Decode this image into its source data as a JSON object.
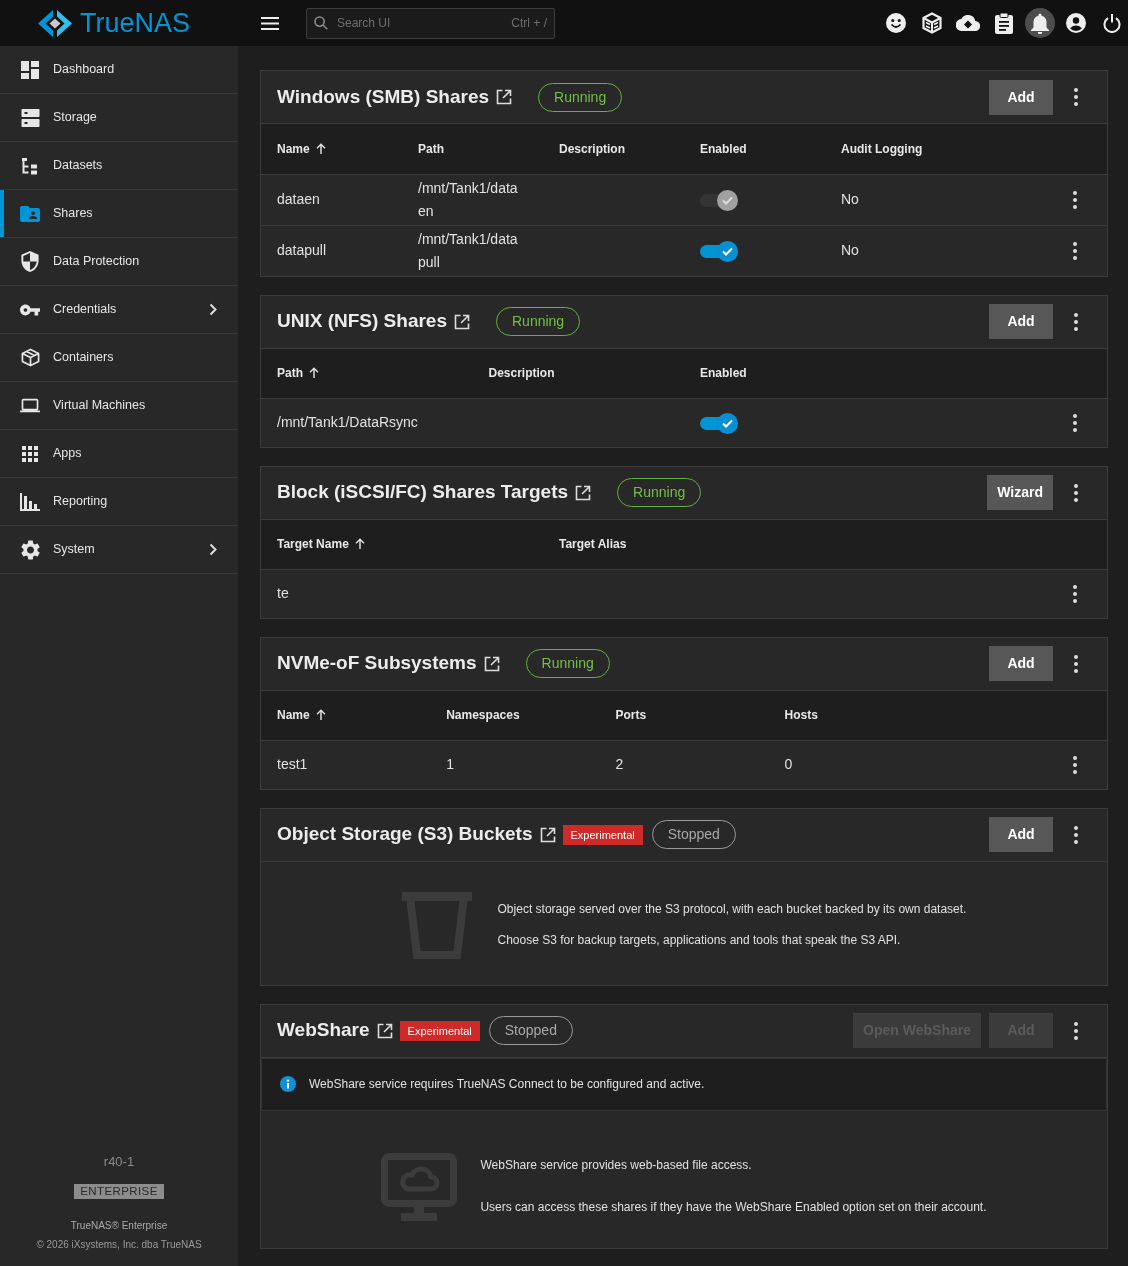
{
  "topbar": {
    "logo_text": "TrueNAS",
    "search": {
      "placeholder": "Search UI",
      "shortcut": "Ctrl + /"
    },
    "actions": [
      {
        "kind": "feedback",
        "highlighted": false
      },
      {
        "kind": "truecommand",
        "highlighted": false
      },
      {
        "kind": "connect",
        "highlighted": false
      },
      {
        "kind": "jobs",
        "highlighted": false
      },
      {
        "kind": "alerts",
        "highlighted": true
      },
      {
        "kind": "account",
        "highlighted": false
      },
      {
        "kind": "power",
        "highlighted": false
      }
    ]
  },
  "sidebar": {
    "items": [
      {
        "label": "Dashboard",
        "selected": false,
        "expandable": false
      },
      {
        "label": "Storage",
        "selected": false,
        "expandable": false
      },
      {
        "label": "Datasets",
        "selected": false,
        "expandable": false
      },
      {
        "label": "Shares",
        "selected": true,
        "expandable": false
      },
      {
        "label": "Data Protection",
        "selected": false,
        "expandable": false
      },
      {
        "label": "Credentials",
        "selected": false,
        "expandable": true
      },
      {
        "label": "Containers",
        "selected": false,
        "expandable": false
      },
      {
        "label": "Virtual Machines",
        "selected": false,
        "expandable": false
      },
      {
        "label": "Apps",
        "selected": false,
        "expandable": false
      },
      {
        "label": "Reporting",
        "selected": false,
        "expandable": false
      },
      {
        "label": "System",
        "selected": false,
        "expandable": true
      }
    ],
    "footer": {
      "hostname": "r40-1",
      "edition": "ENTERPRISE",
      "product": "TrueNAS® Enterprise",
      "copyright": "© 2026 iXsystems, Inc. dba",
      "copyright_link": "TrueNAS"
    }
  },
  "cards": [
    {
      "kind": "table",
      "title": "Windows (SMB) Shares",
      "status": {
        "kind": "running",
        "label": "Running"
      },
      "buttons": [
        {
          "label": "Add",
          "disabled": false
        }
      ],
      "columns": [
        {
          "label": "Name",
          "kind": "text",
          "sorted": true
        },
        {
          "label": "Path",
          "kind": "text",
          "sorted": false
        },
        {
          "label": "Description",
          "kind": "text",
          "sorted": false
        },
        {
          "label": "Enabled",
          "kind": "toggle",
          "sorted": false
        },
        {
          "label": "Audit Logging",
          "kind": "text",
          "sorted": false
        }
      ],
      "rows": [
        {
          "cells": [
            "dataen",
            "/mnt/Tank1/dataen",
            null,
            false,
            "No"
          ]
        },
        {
          "cells": [
            "datapull",
            "/mnt/Tank1/datapull",
            null,
            true,
            "No"
          ]
        }
      ]
    },
    {
      "kind": "table",
      "title": "UNIX (NFS) Shares",
      "status": {
        "kind": "running",
        "label": "Running"
      },
      "buttons": [
        {
          "label": "Add",
          "disabled": false
        }
      ],
      "columns": [
        {
          "label": "Path",
          "kind": "text",
          "sorted": true
        },
        {
          "label": "Description",
          "kind": "text",
          "sorted": false
        },
        {
          "label": "Enabled",
          "kind": "toggle",
          "sorted": false
        }
      ],
      "rows": [
        {
          "cells": [
            "/mnt/Tank1/DataRsync",
            null,
            true
          ]
        }
      ]
    },
    {
      "kind": "table",
      "title": "Block (iSCSI/FC) Shares Targets",
      "status": {
        "kind": "running",
        "label": "Running"
      },
      "buttons": [
        {
          "label": "Wizard",
          "disabled": false
        }
      ],
      "columns": [
        {
          "label": "Target Name",
          "kind": "text",
          "sorted": true
        },
        {
          "label": "Target Alias",
          "kind": "text",
          "sorted": false
        }
      ],
      "rows": [
        {
          "cells": [
            "te",
            null
          ]
        }
      ]
    },
    {
      "kind": "table",
      "title": "NVMe-oF Subsystems",
      "status": {
        "kind": "running",
        "label": "Running"
      },
      "buttons": [
        {
          "label": "Add",
          "disabled": false
        }
      ],
      "columns": [
        {
          "label": "Name",
          "kind": "text",
          "sorted": true
        },
        {
          "label": "Namespaces",
          "kind": "text",
          "sorted": false
        },
        {
          "label": "Ports",
          "kind": "text",
          "sorted": false
        },
        {
          "label": "Hosts",
          "kind": "text",
          "sorted": false
        }
      ],
      "rows": [
        {
          "cells": [
            "test1",
            "1",
            "2",
            "0"
          ]
        }
      ]
    },
    {
      "kind": "object_storage",
      "title": "Object Storage (S3) Buckets",
      "tag": "Experimental",
      "status": {
        "kind": "stopped",
        "label": "Stopped"
      },
      "buttons": [
        {
          "label": "Add",
          "disabled": false
        }
      ],
      "description": [
        "Object storage served over the S3 protocol, with each bucket backed by its own dataset.",
        "Choose S3 for backup targets, applications and tools that speak the S3 API."
      ]
    },
    {
      "kind": "webshare",
      "title": "WebShare",
      "tag": "Experimental",
      "status": {
        "kind": "stopped",
        "label": "Stopped"
      },
      "buttons": [
        {
          "label": "Open WebShare",
          "disabled": true
        },
        {
          "label": "Add",
          "disabled": true
        }
      ],
      "notice": "WebShare service requires TrueNAS Connect to be configured and active.",
      "description": [
        "WebShare service provides web-based file access.",
        "Users can access these shares if they have the WebShare Enabled option set on their account."
      ]
    }
  ]
}
